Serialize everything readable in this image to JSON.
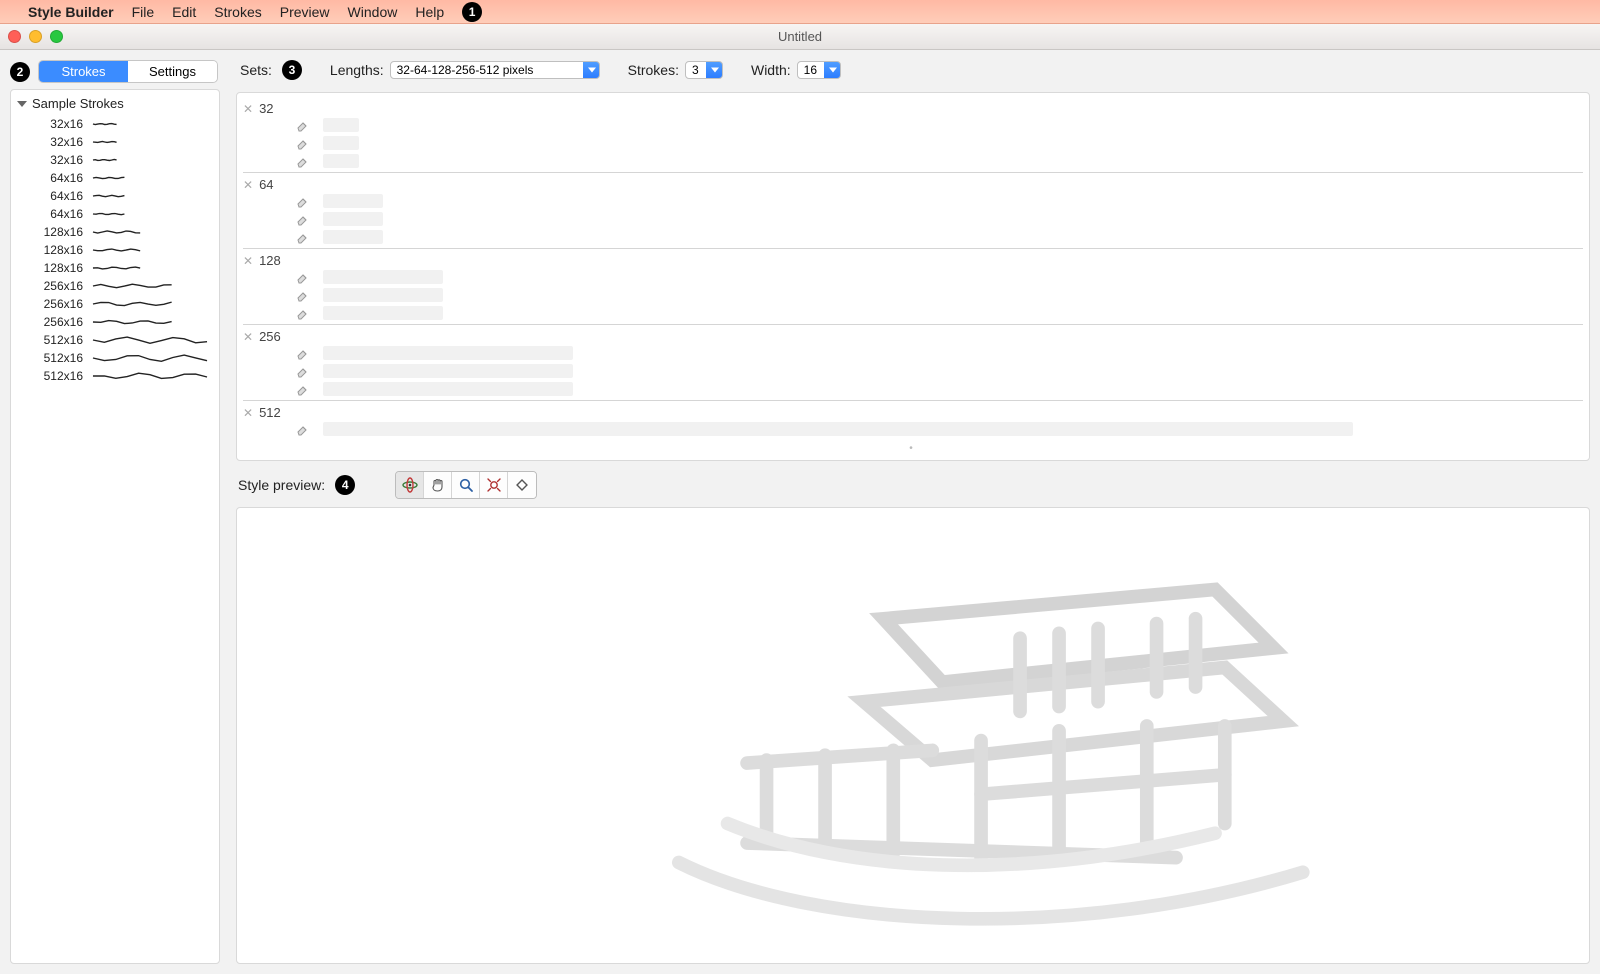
{
  "menubar": {
    "app_name": "Style Builder",
    "items": [
      "File",
      "Edit",
      "Strokes",
      "Preview",
      "Window",
      "Help"
    ]
  },
  "callouts": {
    "menubar": "1",
    "sidebar": "2",
    "sets": "3",
    "preview": "4"
  },
  "window": {
    "title": "Untitled"
  },
  "sidebar": {
    "tabs": {
      "strokes": "Strokes",
      "settings": "Settings"
    },
    "group_title": "Sample Strokes",
    "items": [
      {
        "dims": "32x16",
        "len": 32
      },
      {
        "dims": "32x16",
        "len": 32
      },
      {
        "dims": "32x16",
        "len": 32
      },
      {
        "dims": "64x16",
        "len": 64
      },
      {
        "dims": "64x16",
        "len": 64
      },
      {
        "dims": "64x16",
        "len": 64
      },
      {
        "dims": "128x16",
        "len": 128
      },
      {
        "dims": "128x16",
        "len": 128
      },
      {
        "dims": "128x16",
        "len": 128
      },
      {
        "dims": "256x16",
        "len": 256
      },
      {
        "dims": "256x16",
        "len": 256
      },
      {
        "dims": "256x16",
        "len": 256
      },
      {
        "dims": "512x16",
        "len": 512
      },
      {
        "dims": "512x16",
        "len": 512
      },
      {
        "dims": "512x16",
        "len": 512
      }
    ]
  },
  "sets_bar": {
    "sets_label": "Sets:",
    "lengths_label": "Lengths:",
    "lengths_value": "32-64-128-256-512 pixels",
    "strokes_label": "Strokes:",
    "strokes_value": "3",
    "width_label": "Width:",
    "width_value": "16"
  },
  "sets": [
    {
      "len": "32",
      "rows": 3,
      "slot": 36
    },
    {
      "len": "64",
      "rows": 3,
      "slot": 60
    },
    {
      "len": "128",
      "rows": 3,
      "slot": 120
    },
    {
      "len": "256",
      "rows": 3,
      "slot": 250
    },
    {
      "len": "512",
      "rows": 1,
      "slot": 1030
    }
  ],
  "preview": {
    "label": "Style preview:"
  }
}
